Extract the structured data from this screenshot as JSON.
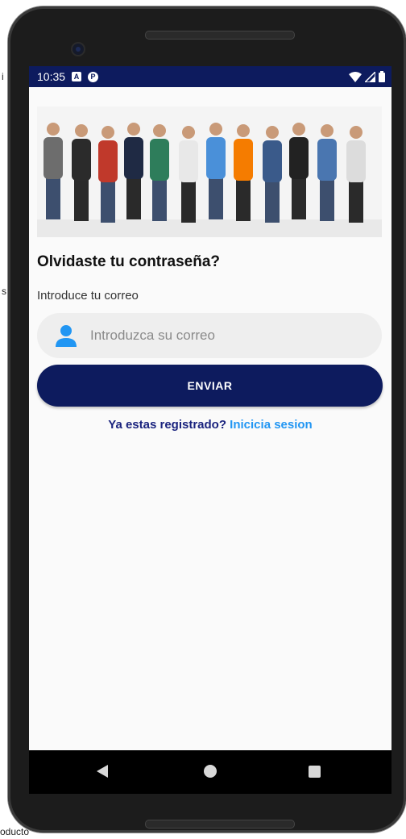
{
  "background": {
    "left_fragment_1": "i",
    "left_fragment_2": "s",
    "bottom_fragment": "oducto"
  },
  "statusbar": {
    "time": "10:35",
    "notification_icons": [
      "a-icon",
      "p-icon"
    ],
    "right_icons": [
      "wifi-icon",
      "signal-icon",
      "battery-icon"
    ]
  },
  "hero": {
    "image": "workers-group-photo"
  },
  "form": {
    "title": "Olvidaste tu contraseña?",
    "label": "Introduce tu correo",
    "email_placeholder": "Introduzca su correo",
    "email_value": "",
    "submit_label": "ENVIAR",
    "login_question": "Ya estas registrado?",
    "login_link": "Inicicia sesion"
  },
  "navbar": {
    "buttons": [
      "back",
      "home",
      "recents"
    ]
  },
  "colors": {
    "primary": "#0d1b5e",
    "link": "#2196f3",
    "question": "#1a237e",
    "input_bg": "#eeeeee",
    "person_icon": "#2196f3"
  }
}
